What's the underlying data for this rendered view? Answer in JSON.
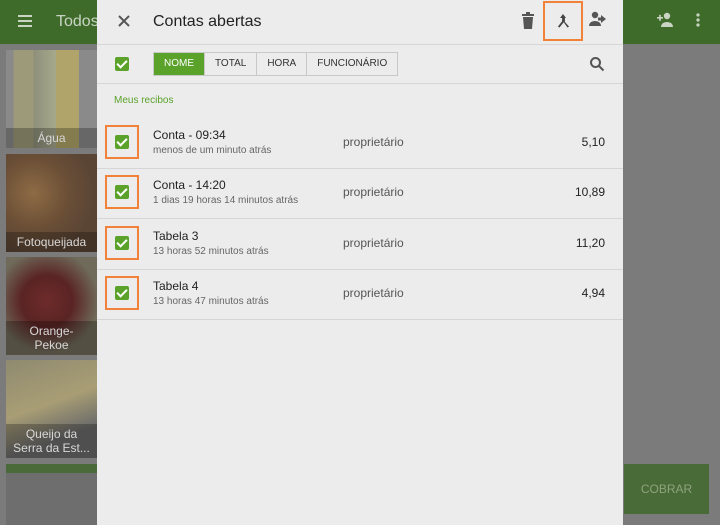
{
  "background": {
    "title": "Todos",
    "tiles": [
      {
        "label": "Água"
      },
      {
        "label": "Fotoqueijada"
      },
      {
        "label": "Orange-\nPekoe"
      },
      {
        "label": "Queijo da\nSerra da Est..."
      }
    ],
    "cobrar_label": "COBRAR"
  },
  "dialog": {
    "title": "Contas abertas",
    "sort_options": [
      {
        "label": "NOME",
        "active": true
      },
      {
        "label": "TOTAL",
        "active": false
      },
      {
        "label": "HORA",
        "active": false
      },
      {
        "label": "FUNCIONÁRIO",
        "active": false
      }
    ],
    "section_label": "Meus recibos",
    "receipts": [
      {
        "name": "Conta - 09:34",
        "time": "menos de um minuto atrás",
        "employee": "proprietário",
        "total": "5,10",
        "checked": true
      },
      {
        "name": "Conta - 14:20",
        "time": "1 dias 19 horas 14 minutos  atrás",
        "employee": "proprietário",
        "total": "10,89",
        "checked": true
      },
      {
        "name": "Tabela 3",
        "time": "13 horas 52 minutos  atrás",
        "employee": "proprietário",
        "total": "11,20",
        "checked": true
      },
      {
        "name": "Tabela 4",
        "time": "13 horas 47 minutos  atrás",
        "employee": "proprietário",
        "total": "4,94",
        "checked": true
      }
    ]
  },
  "colors": {
    "accent": "#5aa22a",
    "highlight": "#f2823a"
  }
}
